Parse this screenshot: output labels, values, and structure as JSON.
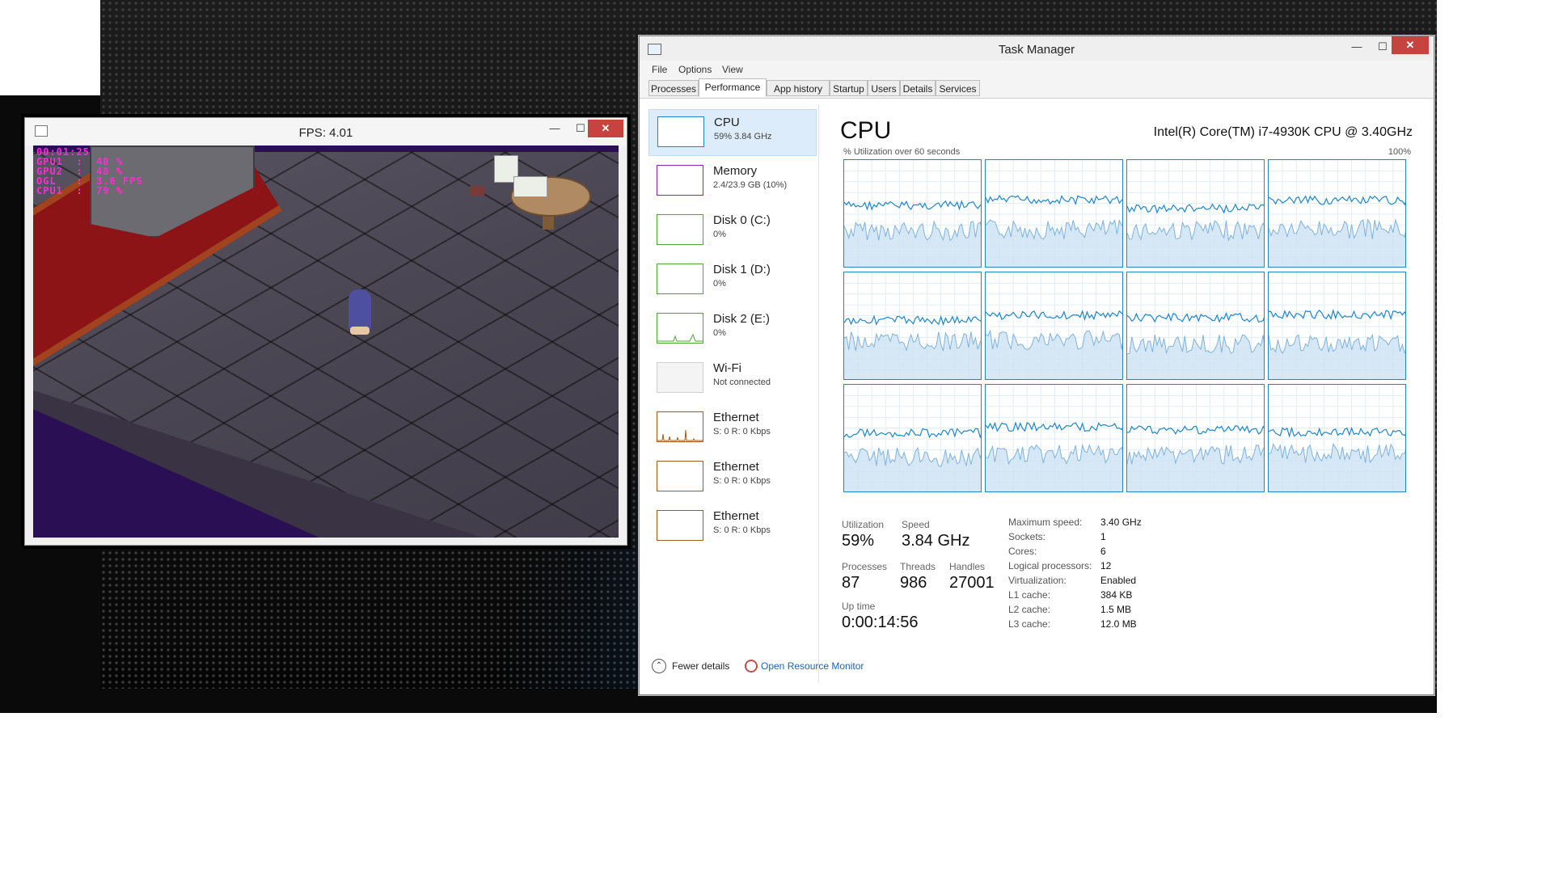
{
  "game_window": {
    "title": "FPS: 4.01",
    "overlay_lines": [
      "00:01:25",
      "GPU1  :  48 %",
      "GPU2  :  48 %",
      "OGL   :  3.6 FPS",
      "CPU1  :  79 %"
    ],
    "controls": {
      "minimize": "—",
      "maximize": "☐",
      "close": "✕"
    }
  },
  "task_manager": {
    "title": "Task Manager",
    "controls": {
      "minimize": "—",
      "maximize": "☐",
      "close": "✕"
    },
    "menu": {
      "file": "File",
      "options": "Options",
      "view": "View"
    },
    "tabs": [
      "Processes",
      "Performance",
      "App history",
      "Startup",
      "Users",
      "Details",
      "Services"
    ],
    "active_tab": "Performance",
    "sidebar": [
      {
        "name": "CPU",
        "sub": "59% 3.84 GHz",
        "color": "#1f86c8",
        "selected": true
      },
      {
        "name": "Memory",
        "sub": "2.4/23.9 GB (10%)",
        "color": "#8b22b5",
        "selected": false
      },
      {
        "name": "Disk 0 (C:)",
        "sub": "0%",
        "color": "#4ea72e",
        "selected": false
      },
      {
        "name": "Disk 1 (D:)",
        "sub": "0%",
        "color": "#4ea72e",
        "selected": false
      },
      {
        "name": "Disk 2 (E:)",
        "sub": "0%",
        "color": "#4ea72e",
        "selected": false
      },
      {
        "name": "Wi-Fi",
        "sub": "Not connected",
        "color": "#d0d0d0",
        "selected": false
      },
      {
        "name": "Ethernet",
        "sub": "S: 0 R: 0 Kbps",
        "color": "#a85a13",
        "selected": false
      },
      {
        "name": "Ethernet",
        "sub": "S: 0 R: 0 Kbps",
        "color": "#a85a13",
        "selected": false
      },
      {
        "name": "Ethernet",
        "sub": "S: 0 R: 0 Kbps",
        "color": "#a85a13",
        "selected": false
      }
    ],
    "cpu": {
      "title": "CPU",
      "model": "Intel(R) Core(TM) i7-4930K CPU @ 3.40GHz",
      "graph_label": "% Utilization over 60 seconds",
      "graph_max": "100%",
      "core_count": 12,
      "graph_color": "#1f86c8"
    },
    "stats": {
      "utilization_label": "Utilization",
      "utilization": "59%",
      "speed_label": "Speed",
      "speed": "3.84 GHz",
      "processes_label": "Processes",
      "processes": "87",
      "threads_label": "Threads",
      "threads": "986",
      "handles_label": "Handles",
      "handles": "27001",
      "uptime_label": "Up time",
      "uptime": "0:00:14:56"
    },
    "specs": [
      {
        "label": "Maximum speed:",
        "value": "3.40 GHz"
      },
      {
        "label": "Sockets:",
        "value": "1"
      },
      {
        "label": "Cores:",
        "value": "6"
      },
      {
        "label": "Logical processors:",
        "value": "12"
      },
      {
        "label": "Virtualization:",
        "value": "Enabled"
      },
      {
        "label": "L1 cache:",
        "value": "384 KB"
      },
      {
        "label": "L2 cache:",
        "value": "1.5 MB"
      },
      {
        "label": "L3 cache:",
        "value": "12.0 MB"
      }
    ],
    "footer": {
      "fewer_details": "Fewer details",
      "open_monitor": "Open Resource Monitor"
    }
  }
}
